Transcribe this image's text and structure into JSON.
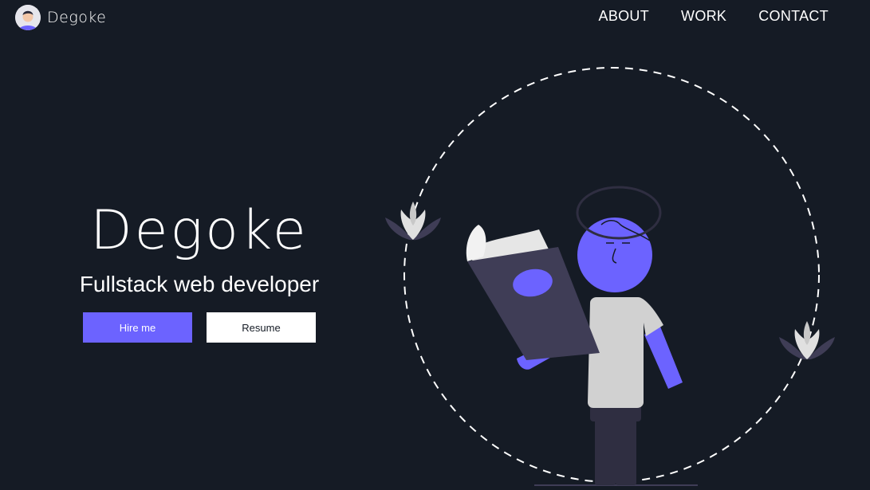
{
  "header": {
    "brand_name": "Degoke",
    "nav": [
      {
        "label": "ABOUT"
      },
      {
        "label": "WORK"
      },
      {
        "label": "CONTACT"
      }
    ]
  },
  "hero": {
    "title": "Degoke",
    "subtitle": "Fullstack web developer",
    "primary_button": "Hire me",
    "secondary_button": "Resume"
  },
  "colors": {
    "background": "#151b25",
    "accent": "#6c63ff",
    "white": "#ffffff",
    "book_dark": "#3f3d56",
    "shirt": "#d1d1d1"
  },
  "icons": {
    "avatar": "avatar-icon",
    "illustration": "reading-person-illustration"
  }
}
